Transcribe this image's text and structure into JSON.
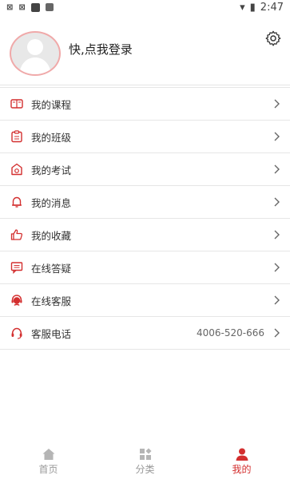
{
  "status": {
    "left_icons": [
      "sim-icon",
      "sim-icon",
      "app-notification-icon",
      "font-icon"
    ],
    "time": "2:47"
  },
  "profile": {
    "login_text": "快,点我登录"
  },
  "menu": [
    {
      "label": "我的课程",
      "icon": "book-icon"
    },
    {
      "label": "我的班级",
      "icon": "clipboard-icon"
    },
    {
      "label": "我的考试",
      "icon": "exam-icon"
    },
    {
      "label": "我的消息",
      "icon": "bell-icon"
    },
    {
      "label": "我的收藏",
      "icon": "thumbs-up-icon"
    },
    {
      "label": "在线答疑",
      "icon": "chat-icon"
    },
    {
      "label": "在线客服",
      "icon": "customer-service-icon"
    },
    {
      "label": "客服电话",
      "icon": "headset-icon",
      "value": "4006-520-666"
    }
  ],
  "tabs": [
    {
      "label": "首页",
      "icon": "home-icon"
    },
    {
      "label": "分类",
      "icon": "grid-icon"
    },
    {
      "label": "我的",
      "icon": "user-icon",
      "active": true
    }
  ],
  "colors": {
    "accent": "#d32f2f"
  }
}
